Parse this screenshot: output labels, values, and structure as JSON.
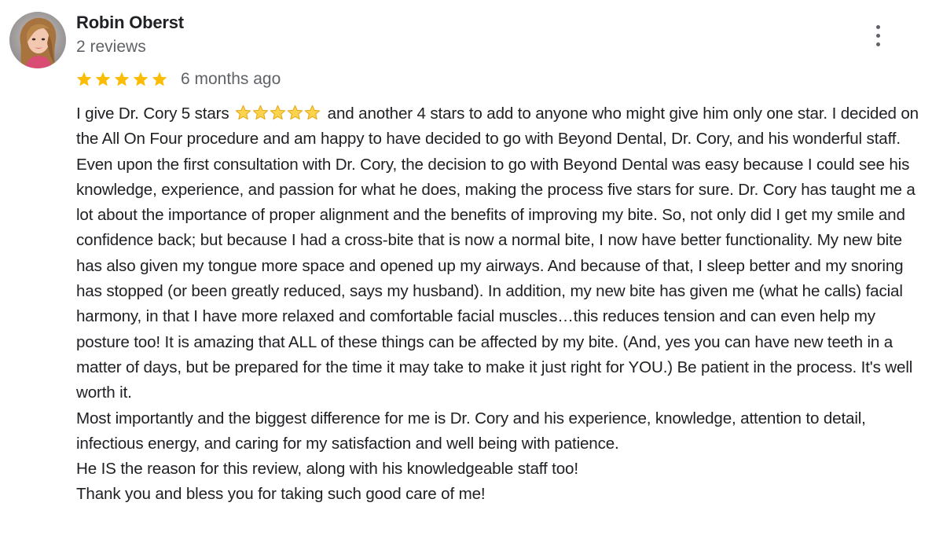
{
  "reviewer": {
    "name": "Robin Oberst",
    "review_count": "2 reviews"
  },
  "rating": {
    "stars": 5,
    "max": 5,
    "star_color": "#fbbc04",
    "time_ago": "6 months ago"
  },
  "menu": {
    "icon": "more-vertical-icon"
  },
  "review": {
    "intro_before_stars": "I give Dr. Cory 5 stars ",
    "emoji_stars_count": 5,
    "emoji_icon": "star-emoji-icon",
    "intro_after_stars": " and another 4 stars to add to anyone who might give him only one star.  I decided on the All On Four procedure and am happy to have decided to go with Beyond Dental, Dr. Cory, and his wonderful staff. Even upon the first consultation with Dr. Cory, the decision to go with Beyond Dental was easy because I could see his knowledge, experience, and passion for what he does, making the process five stars for sure.  Dr. Cory has taught me a lot about the importance of proper alignment and the benefits of improving my bite. So, not only did I get my smile and confidence back; but because I had a cross-bite that is now a normal bite, I now have better functionality. My new bite has also given my tongue more space and opened up my airways. And because of that, I sleep better and my snoring has stopped (or been greatly reduced, says my husband).  In addition, my new bite has given me (what he calls) facial harmony, in that I have more relaxed and comfortable facial muscles…this reduces tension and can even help my posture too!  It is amazing that ALL of these things can be affected by my bite. (And, yes you can have new teeth in a matter of days, but be prepared for the time it may take to make it just right for YOU.)  Be patient in the process. It's well worth it.",
    "paragraph_2": "Most importantly and the biggest difference for me is Dr. Cory and his experience, knowledge, attention to detail, infectious energy, and caring for my satisfaction and well being with patience.",
    "paragraph_3": "He IS the reason for this review, along with his knowledgeable staff too!",
    "paragraph_4": "Thank you and bless you for taking such good care of me!"
  }
}
